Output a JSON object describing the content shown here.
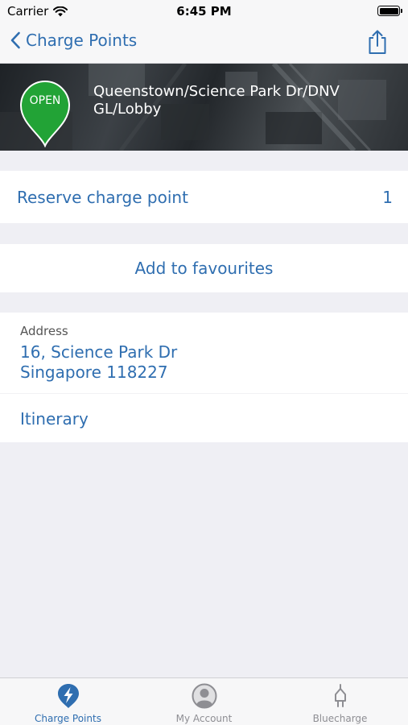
{
  "status_bar": {
    "carrier": "Carrier",
    "time": "6:45 PM"
  },
  "nav": {
    "back_label": "Charge Points"
  },
  "charge_point": {
    "status": "OPEN",
    "status_color": "#22a336",
    "name": "Queenstown/Science Park Dr/DNV GL/Lobby"
  },
  "reserve": {
    "label": "Reserve charge point",
    "count": "1"
  },
  "favourites": {
    "label": "Add to favourites"
  },
  "address": {
    "caption": "Address",
    "line1": "16, Science Park Dr",
    "line2": "Singapore 118227",
    "itinerary_label": "Itinerary"
  },
  "tabs": [
    {
      "label": "Charge Points",
      "icon": "lightning-bolt-icon",
      "active": true
    },
    {
      "label": "My Account",
      "icon": "user-avatar-icon",
      "active": false
    },
    {
      "label": "Bluecharge",
      "icon": "plug-icon",
      "active": false
    }
  ],
  "colors": {
    "accent": "#2f6eb0",
    "background": "#efeff4",
    "inactive_tab": "#8e8e93"
  }
}
